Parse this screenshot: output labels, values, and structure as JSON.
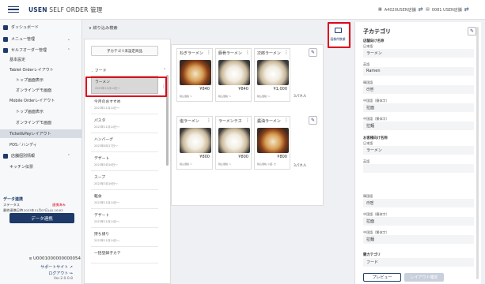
{
  "header": {
    "brand_bold": "USEN",
    "brand_rest": " SELF ORDER 管理",
    "store1": "A4020USEN店舗",
    "store2": "0081 USEN店舗"
  },
  "sidebar": {
    "items": [
      {
        "label": "ダッシュボード"
      },
      {
        "label": "メニュー管理"
      },
      {
        "label": "セルフオーダー管理"
      },
      {
        "label": "基本設定"
      },
      {
        "label": "Tablet Orderレイアウト"
      },
      {
        "label": "トップ画面表示"
      },
      {
        "label": "オンラインデモ画面"
      },
      {
        "label": "Mobile Orderレイアウト"
      },
      {
        "label": "トップ画面表示"
      },
      {
        "label": "オンラインデモ画面"
      },
      {
        "label": "Ticket&Payレイアウト"
      },
      {
        "label": "POS／ハンディ"
      },
      {
        "label": "店舗個別情報"
      },
      {
        "label": "キッチン伝票"
      }
    ],
    "data_link": {
      "title": "データ連携",
      "status_label": "ステータス",
      "status_value": "連携済み",
      "last_label": "最終連携日時",
      "last_value": "2023年11月07日(火) 10:02",
      "button": "データ連携"
    },
    "account": "U0001000000000054",
    "support": "サポートサイト",
    "logout": "ログアウト",
    "version": "Ver.2.0.0.8"
  },
  "main": {
    "filter": "絞り込み検索",
    "unset_button": "子カテゴリ未設定商品",
    "parent_category": "フード",
    "categories": [
      {
        "name": "ラーメン",
        "date": "2023年11月14日～"
      },
      {
        "name": "今月のおすすめ",
        "date": "2023年11月14日～"
      },
      {
        "name": "パスタ",
        "date": "2023年11月14日～"
      },
      {
        "name": "ハンバーグ",
        "date": "2023年8月17日～"
      },
      {
        "name": "デザート",
        "date": "2023年5月16日～"
      },
      {
        "name": "スープ",
        "date": "2023年3月16日～"
      },
      {
        "name": "軽食",
        "date": "2023年11月14日～"
      },
      {
        "name": "デザート",
        "date": "2023年11月14日～"
      },
      {
        "name": "持ち帰り",
        "date": "2023年11月14日～"
      },
      {
        "name": "一括登録子カテ",
        "date": ""
      }
    ],
    "row1": [
      {
        "name": "ねぎラーメン",
        "price": "¥840",
        "tag": "税込価格 ～"
      },
      {
        "name": "豚骨ラーメン",
        "price": "¥840",
        "tag": "税込価格 ～"
      },
      {
        "name": "次郎ラーメン",
        "price": "¥1,000",
        "tag": "税込価格 ～"
      }
    ],
    "row2": [
      {
        "name": "塩ラーメン",
        "price": "¥800",
        "tag": "税込価格 ～"
      },
      {
        "name": "ラーメンテス",
        "price": "¥800",
        "tag": "税込価格 ～"
      },
      {
        "name": "醤油ラーメン",
        "price": "¥800",
        "tag": "税込価格 小盛, 大"
      }
    ],
    "more": "3パネル"
  },
  "side_icon_label": "画像件数順",
  "right_panel": {
    "title": "子カテゴリ",
    "field1": "店舗向け名称",
    "lang_ja": "日本語",
    "v_ja": "ラーメン",
    "lang_en": "英語",
    "v_en": "Ramen",
    "lang_ko": "韓国語",
    "v_ko": "라멘",
    "lang_zh1": "中国語（簡体字）",
    "v_zh1": "拉面",
    "lang_zh2": "中国語（繁体字）",
    "v_zh2": "拉麵",
    "field2": "お客様向け名称",
    "lang_ja2": "日本語",
    "v_ja2": "ラーメン",
    "lang_en2": "英語",
    "v_en2": "",
    "lang_ko2": "韓国語",
    "v_ko2": "라멘",
    "lang_zh3": "中国語（簡体字）",
    "v_zh3": "拉面",
    "lang_zh4": "中国語（繁体字）",
    "v_zh4": "拉麵",
    "parent_label": "親カテゴリ",
    "parent_value": "フード",
    "preview_btn": "プレビュー",
    "apply_btn": "レイアウト確定"
  }
}
